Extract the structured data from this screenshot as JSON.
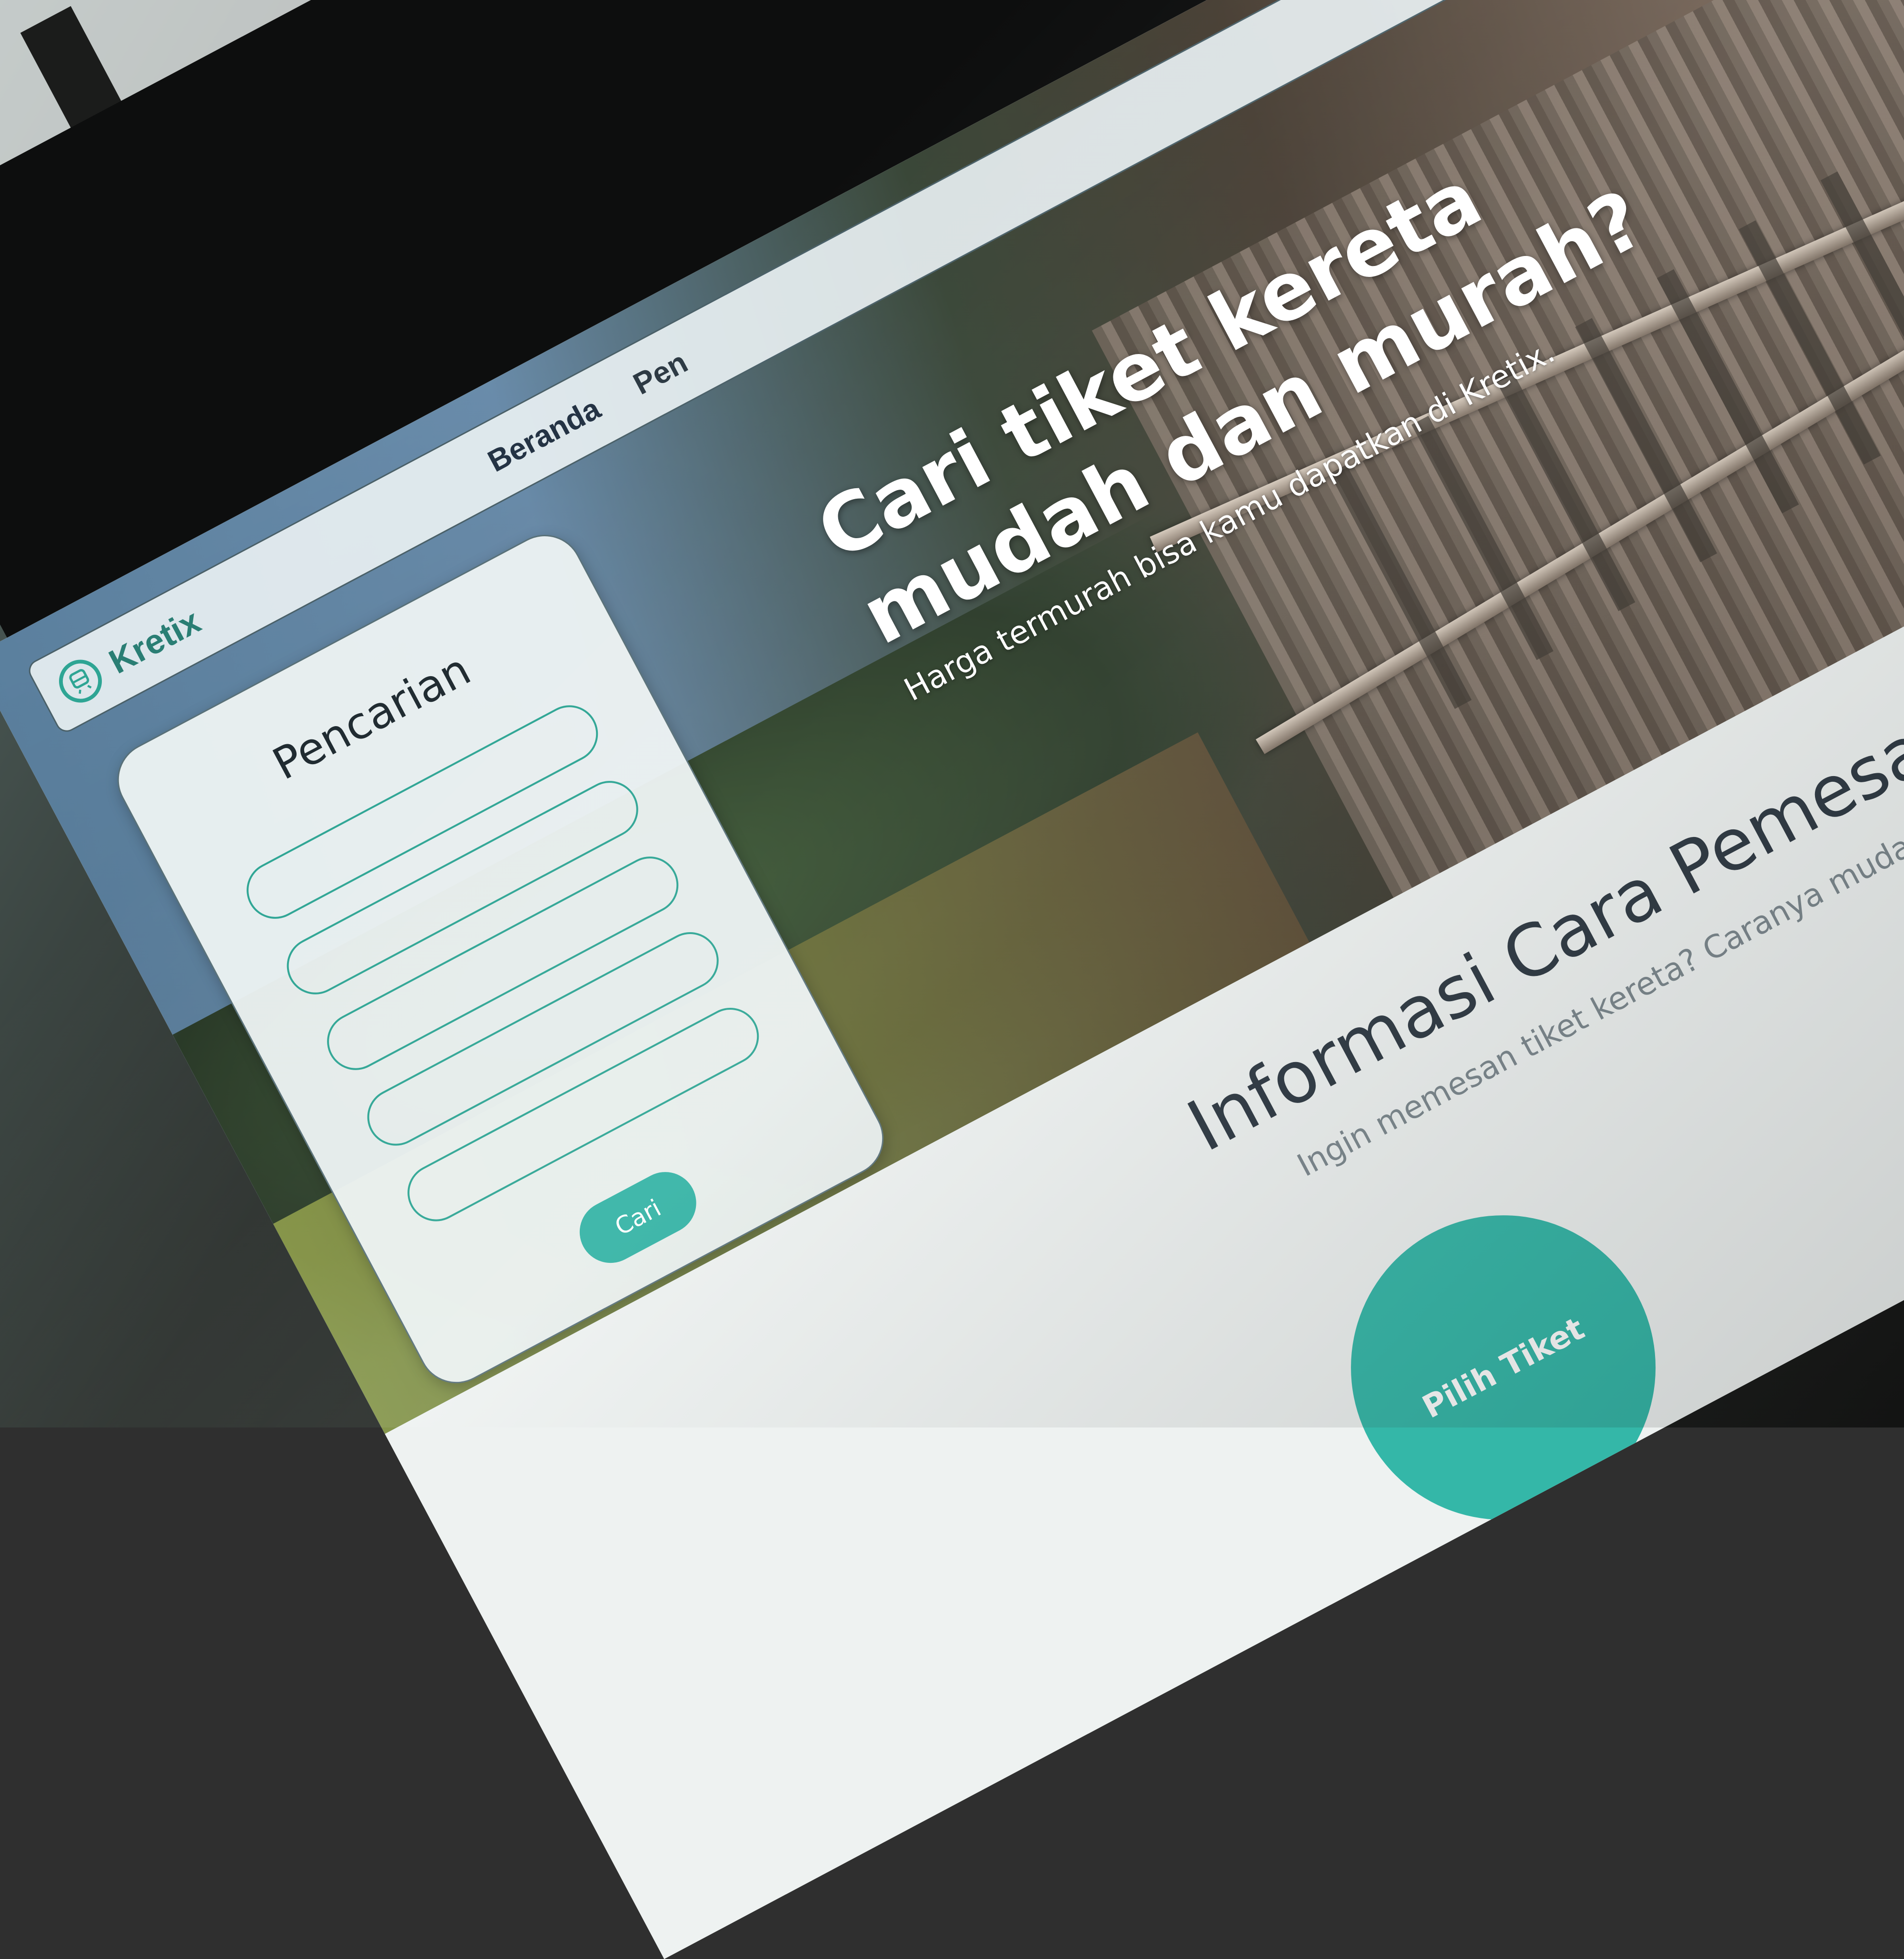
{
  "brand": {
    "name": "Kretix",
    "logo_icon": "train-icon",
    "accent_color": "#33b3a5"
  },
  "nav": {
    "items": [
      {
        "label": "Beranda"
      },
      {
        "label": "Pen"
      }
    ]
  },
  "search": {
    "title": "Pencarian",
    "fields": [
      "",
      "",
      "",
      "",
      ""
    ],
    "button_label": "Cari"
  },
  "hero": {
    "title_line1": "Cari tiket kereta",
    "title_line2": "mudah dan murah?",
    "subtitle": "Harga termurah bisa kamu dapatkan di Kretix."
  },
  "info": {
    "title": "Informasi Cara Pemesanan Tik",
    "subtitle": "Ingin memesan tiket kereta? Caranya mudah sekali!",
    "steps": [
      {
        "label": "Pilih Tiket"
      },
      {
        "label": ""
      }
    ]
  }
}
